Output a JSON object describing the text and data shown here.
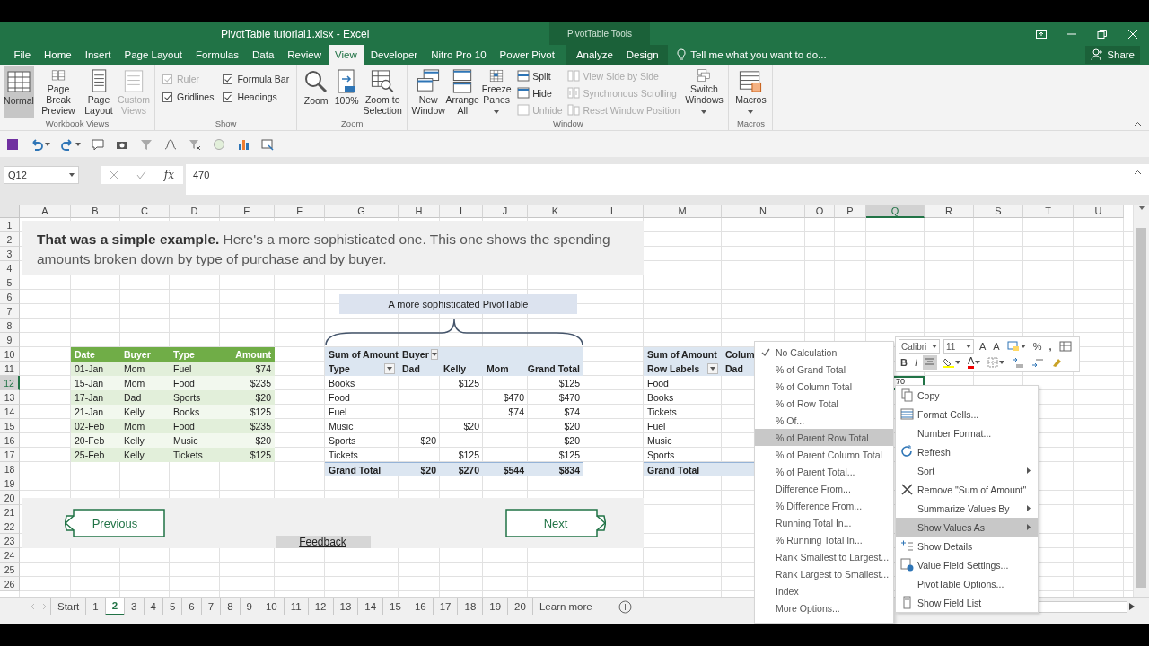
{
  "window": {
    "title": "PivotTable tutorial1.xlsx - Excel",
    "context_group": "PivotTable Tools"
  },
  "ribbon_tabs": [
    {
      "label": "File",
      "selected": false,
      "contextual": false
    },
    {
      "label": "Home",
      "selected": false,
      "contextual": false
    },
    {
      "label": "Insert",
      "selected": false,
      "contextual": false
    },
    {
      "label": "Page Layout",
      "selected": false,
      "contextual": false
    },
    {
      "label": "Formulas",
      "selected": false,
      "contextual": false
    },
    {
      "label": "Data",
      "selected": false,
      "contextual": false
    },
    {
      "label": "Review",
      "selected": false,
      "contextual": false
    },
    {
      "label": "View",
      "selected": true,
      "contextual": false
    },
    {
      "label": "Developer",
      "selected": false,
      "contextual": false
    },
    {
      "label": "Nitro Pro 10",
      "selected": false,
      "contextual": false
    },
    {
      "label": "Power Pivot",
      "selected": false,
      "contextual": false
    },
    {
      "label": "Analyze",
      "selected": false,
      "contextual": true
    },
    {
      "label": "Design",
      "selected": false,
      "contextual": true
    }
  ],
  "tell_me": {
    "placeholder": "Tell me what you want to do..."
  },
  "share": "Share",
  "ribbon_groups": [
    {
      "label": "Workbook Views",
      "items": [
        {
          "kind": "large",
          "label": "Normal",
          "selected": true,
          "disabled": false,
          "dropdown": false
        },
        {
          "kind": "large",
          "label": "Page Break Preview",
          "selected": false,
          "disabled": false,
          "dropdown": false
        },
        {
          "kind": "large",
          "label": "Page Layout",
          "selected": false,
          "disabled": false,
          "dropdown": false
        },
        {
          "kind": "large",
          "label": "Custom Views",
          "selected": false,
          "disabled": true,
          "dropdown": false
        }
      ]
    },
    {
      "label": "Show",
      "items": [
        {
          "kind": "check",
          "label": "Ruler",
          "checked": true,
          "disabled": true
        },
        {
          "kind": "check",
          "label": "Formula Bar",
          "checked": true,
          "disabled": false
        },
        {
          "kind": "check",
          "label": "Gridlines",
          "checked": true,
          "disabled": false
        },
        {
          "kind": "check",
          "label": "Headings",
          "checked": true,
          "disabled": false
        }
      ]
    },
    {
      "label": "Zoom",
      "items": [
        {
          "kind": "large",
          "label": "Zoom",
          "selected": false,
          "disabled": false,
          "dropdown": false
        },
        {
          "kind": "large",
          "label": "100%",
          "selected": false,
          "disabled": false,
          "dropdown": false
        },
        {
          "kind": "large",
          "label": "Zoom to Selection",
          "selected": false,
          "disabled": false,
          "dropdown": false
        }
      ]
    },
    {
      "label": "Window",
      "items": [
        {
          "kind": "large",
          "label": "New Window",
          "selected": false,
          "disabled": false,
          "dropdown": false
        },
        {
          "kind": "large",
          "label": "Arrange All",
          "selected": false,
          "disabled": false,
          "dropdown": false
        },
        {
          "kind": "large",
          "label": "Freeze Panes",
          "selected": false,
          "disabled": false,
          "dropdown": true
        },
        {
          "kind": "stack",
          "items": [
            {
              "label": "Split",
              "disabled": false
            },
            {
              "label": "Hide",
              "disabled": false
            },
            {
              "label": "Unhide",
              "disabled": true
            }
          ]
        },
        {
          "kind": "stack",
          "items": [
            {
              "label": "View Side by Side",
              "disabled": true
            },
            {
              "label": "Synchronous Scrolling",
              "disabled": true
            },
            {
              "label": "Reset Window Position",
              "disabled": true
            }
          ]
        },
        {
          "kind": "large",
          "label": "Switch Windows",
          "selected": false,
          "disabled": false,
          "dropdown": true
        }
      ]
    },
    {
      "label": "Macros",
      "items": [
        {
          "kind": "large",
          "label": "Macros",
          "selected": false,
          "disabled": false,
          "dropdown": true
        }
      ]
    }
  ],
  "formula_bar": {
    "name_box": "Q12",
    "function_label": "fx",
    "value": "470"
  },
  "columns": [
    {
      "label": "A",
      "selected": false
    },
    {
      "label": "B",
      "selected": false
    },
    {
      "label": "C",
      "selected": false
    },
    {
      "label": "D",
      "selected": false
    },
    {
      "label": "E",
      "selected": false
    },
    {
      "label": "F",
      "selected": false
    },
    {
      "label": "G",
      "selected": false
    },
    {
      "label": "H",
      "selected": false
    },
    {
      "label": "I",
      "selected": false
    },
    {
      "label": "J",
      "selected": false
    },
    {
      "label": "K",
      "selected": false
    },
    {
      "label": "L",
      "selected": false
    },
    {
      "label": "M",
      "selected": false
    },
    {
      "label": "N",
      "selected": false
    },
    {
      "label": "O",
      "selected": false
    },
    {
      "label": "P",
      "selected": false
    },
    {
      "label": "Q",
      "selected": true
    },
    {
      "label": "R",
      "selected": false
    },
    {
      "label": "S",
      "selected": false
    },
    {
      "label": "T",
      "selected": false
    },
    {
      "label": "U",
      "selected": false
    }
  ],
  "rows": [
    {
      "label": "1",
      "selected": false
    },
    {
      "label": "2",
      "selected": false
    },
    {
      "label": "3",
      "selected": false
    },
    {
      "label": "4",
      "selected": false
    },
    {
      "label": "5",
      "selected": false
    },
    {
      "label": "6",
      "selected": false
    },
    {
      "label": "7",
      "selected": false
    },
    {
      "label": "8",
      "selected": false
    },
    {
      "label": "9",
      "selected": false
    },
    {
      "label": "10",
      "selected": false
    },
    {
      "label": "11",
      "selected": false
    },
    {
      "label": "12",
      "selected": true
    },
    {
      "label": "13",
      "selected": false
    },
    {
      "label": "14",
      "selected": false
    },
    {
      "label": "15",
      "selected": false
    },
    {
      "label": "16",
      "selected": false
    },
    {
      "label": "17",
      "selected": false
    },
    {
      "label": "18",
      "selected": false
    },
    {
      "label": "19",
      "selected": false
    },
    {
      "label": "20",
      "selected": false
    },
    {
      "label": "21",
      "selected": false
    },
    {
      "label": "22",
      "selected": false
    },
    {
      "label": "23",
      "selected": false
    },
    {
      "label": "24",
      "selected": false
    },
    {
      "label": "25",
      "selected": false
    },
    {
      "label": "26",
      "selected": false
    }
  ],
  "banner": {
    "text": "**That was a simple example.** Here's a more sophisticated one. This one shows the spending amounts broken down by type of purchase and by buyer."
  },
  "source_table": {
    "columns": [
      "Date",
      "Buyer",
      "Type",
      "Amount"
    ],
    "rows": [
      [
        "01-Jan",
        "Mom",
        "Fuel",
        "$74"
      ],
      [
        "15-Jan",
        "Mom",
        "Food",
        "$235"
      ],
      [
        "17-Jan",
        "Dad",
        "Sports",
        "$20"
      ],
      [
        "21-Jan",
        "Kelly",
        "Books",
        "$125"
      ],
      [
        "02-Feb",
        "Mom",
        "Food",
        "$235"
      ],
      [
        "20-Feb",
        "Kelly",
        "Music",
        "$20"
      ],
      [
        "25-Feb",
        "Kelly",
        "Tickets",
        "$125"
      ]
    ]
  },
  "callout": "A more sophisticated PivotTable",
  "pivot_main": {
    "value_field": "Sum of Amount",
    "column_field": "Buyer",
    "row_field": "Type",
    "columns": [
      "Dad",
      "Kelly",
      "Mom",
      "Grand Total"
    ],
    "rows": [
      {
        "label": "Books",
        "kelly": "$125",
        "grand_total": "$125"
      },
      {
        "label": "Food",
        "mom": "$470",
        "grand_total": "$470"
      },
      {
        "label": "Fuel",
        "mom": "$74",
        "grand_total": "$74"
      },
      {
        "label": "Music",
        "kelly": "$20",
        "grand_total": "$20"
      },
      {
        "label": "Sports",
        "dad": "$20",
        "grand_total": "$20"
      },
      {
        "label": "Tickets",
        "kelly": "$125",
        "grand_total": "$125"
      }
    ],
    "total": {
      "label": "Grand Total",
      "values": [
        "$20",
        "$270",
        "$544",
        "$834"
      ]
    }
  },
  "pivot_second": {
    "value_field": "Sum of Amount",
    "column_field": "Colum",
    "row_field": "Row Labels",
    "column": "Dad",
    "rows": [
      "Food",
      "Books",
      "Tickets",
      "Fuel",
      "Music",
      "Sports"
    ],
    "total_label": "Grand Total"
  },
  "navigation": {
    "previous": "Previous",
    "next": "Next",
    "feedback": "Feedback"
  },
  "active_cell": {
    "text": "70"
  },
  "mini_toolbar": {
    "font": "Calibri",
    "size": "11",
    "grow_font": "A",
    "shrink_font": "A",
    "percent": "%",
    "comma": ",",
    "bold": "B",
    "italic": "I",
    "font_color": "A"
  },
  "context_menu": {
    "items": [
      {
        "label": "Copy",
        "kind": "item",
        "selected": false
      },
      {
        "label": "Format Cells...",
        "kind": "item",
        "selected": false
      },
      {
        "label": "Number Format...",
        "kind": "item",
        "selected": false
      },
      {
        "label": "Refresh",
        "kind": "item",
        "selected": false
      },
      {
        "label": "Sort",
        "kind": "submenu",
        "selected": false
      },
      {
        "label": "Remove \"Sum of Amount\"",
        "kind": "item",
        "selected": false
      },
      {
        "label": "Summarize Values By",
        "kind": "submenu",
        "selected": false
      },
      {
        "label": "Show Values As",
        "kind": "submenu",
        "selected": true
      },
      {
        "label": "Show Details",
        "kind": "item",
        "selected": false
      },
      {
        "label": "Value Field Settings...",
        "kind": "item",
        "selected": false
      },
      {
        "label": "PivotTable Options...",
        "kind": "item",
        "selected": false
      },
      {
        "label": "Show Field List",
        "kind": "item",
        "selected": false
      }
    ]
  },
  "values_submenu": {
    "items": [
      {
        "label": "No Calculation",
        "checked": true,
        "selected": false
      },
      {
        "label": "% of Grand Total",
        "checked": false,
        "selected": false
      },
      {
        "label": "% of Column Total",
        "checked": false,
        "selected": false
      },
      {
        "label": "% of Row Total",
        "checked": false,
        "selected": false
      },
      {
        "label": "% Of...",
        "checked": false,
        "selected": false
      },
      {
        "label": "% of Parent Row Total",
        "checked": false,
        "selected": true
      },
      {
        "label": "% of Parent Column Total",
        "checked": false,
        "selected": false
      },
      {
        "label": "% of Parent Total...",
        "checked": false,
        "selected": false
      },
      {
        "label": "Difference From...",
        "checked": false,
        "selected": false
      },
      {
        "label": "% Difference From...",
        "checked": false,
        "selected": false
      },
      {
        "label": "Running Total In...",
        "checked": false,
        "selected": false
      },
      {
        "label": "% Running Total In...",
        "checked": false,
        "selected": false
      },
      {
        "label": "Rank Smallest to Largest...",
        "checked": false,
        "selected": false
      },
      {
        "label": "Rank Largest to Smallest...",
        "checked": false,
        "selected": false
      },
      {
        "label": "Index",
        "checked": false,
        "selected": false
      },
      {
        "label": "More Options...",
        "checked": false,
        "selected": false
      }
    ]
  },
  "sheet_tabs": [
    {
      "label": "Start",
      "selected": false
    },
    {
      "label": "1",
      "selected": false
    },
    {
      "label": "2",
      "selected": true
    },
    {
      "label": "3",
      "selected": false
    },
    {
      "label": "4",
      "selected": false
    },
    {
      "label": "5",
      "selected": false
    },
    {
      "label": "6",
      "selected": false
    },
    {
      "label": "7",
      "selected": false
    },
    {
      "label": "8",
      "selected": false
    },
    {
      "label": "9",
      "selected": false
    },
    {
      "label": "10",
      "selected": false
    },
    {
      "label": "11",
      "selected": false
    },
    {
      "label": "12",
      "selected": false
    },
    {
      "label": "13",
      "selected": false
    },
    {
      "label": "14",
      "selected": false
    },
    {
      "label": "15",
      "selected": false
    },
    {
      "label": "16",
      "selected": false
    },
    {
      "label": "17",
      "selected": false
    },
    {
      "label": "18",
      "selected": false
    },
    {
      "label": "19",
      "selected": false
    },
    {
      "label": "20",
      "selected": false
    },
    {
      "label": "Learn more",
      "selected": false
    }
  ]
}
